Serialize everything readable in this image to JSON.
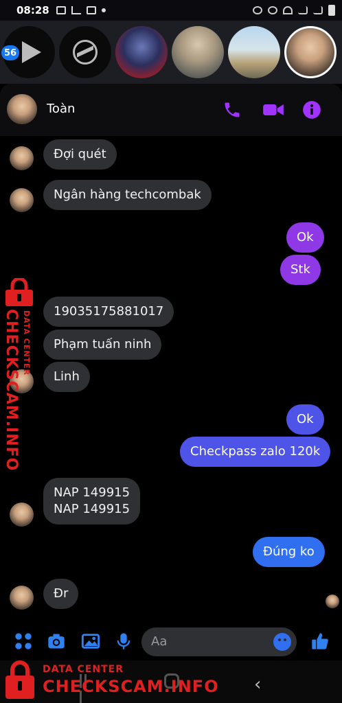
{
  "status_bar": {
    "time": "08:28"
  },
  "chat_heads": {
    "unread_badge": "56"
  },
  "header": {
    "contact_name": "Toàn"
  },
  "messages": [
    {
      "dir": "in",
      "text": "Đợi quét"
    },
    {
      "dir": "in",
      "text": "Ngân hàng techcombak"
    },
    {
      "dir": "out",
      "text": "Ok"
    },
    {
      "dir": "out",
      "text": "Stk"
    },
    {
      "dir": "in",
      "text": "19035175881017"
    },
    {
      "dir": "in",
      "text": "Phạm tuấn ninh"
    },
    {
      "dir": "in",
      "text": "Linh"
    },
    {
      "dir": "out",
      "text": "Ok"
    },
    {
      "dir": "out",
      "text": "Checkpass zalo 120k"
    },
    {
      "dir": "in",
      "text_line1": "NAP 149915",
      "text_line2": "NAP 149915"
    },
    {
      "dir": "out",
      "text": "Đúng ko"
    },
    {
      "dir": "in",
      "text": "Đr"
    }
  ],
  "composer": {
    "placeholder": "Aa"
  },
  "watermark": {
    "line1": "DATA CENTER",
    "line2": "CHECKSCAM.INFO"
  },
  "colors": {
    "bubble_in": "#2f3033",
    "bubble_out_purple": "#8f39e6",
    "bubble_out_indigo": "#4e54e8",
    "bubble_out_blue": "#2f6ff0",
    "accent_purple": "#a033ff",
    "watermark_red": "#e02020"
  }
}
